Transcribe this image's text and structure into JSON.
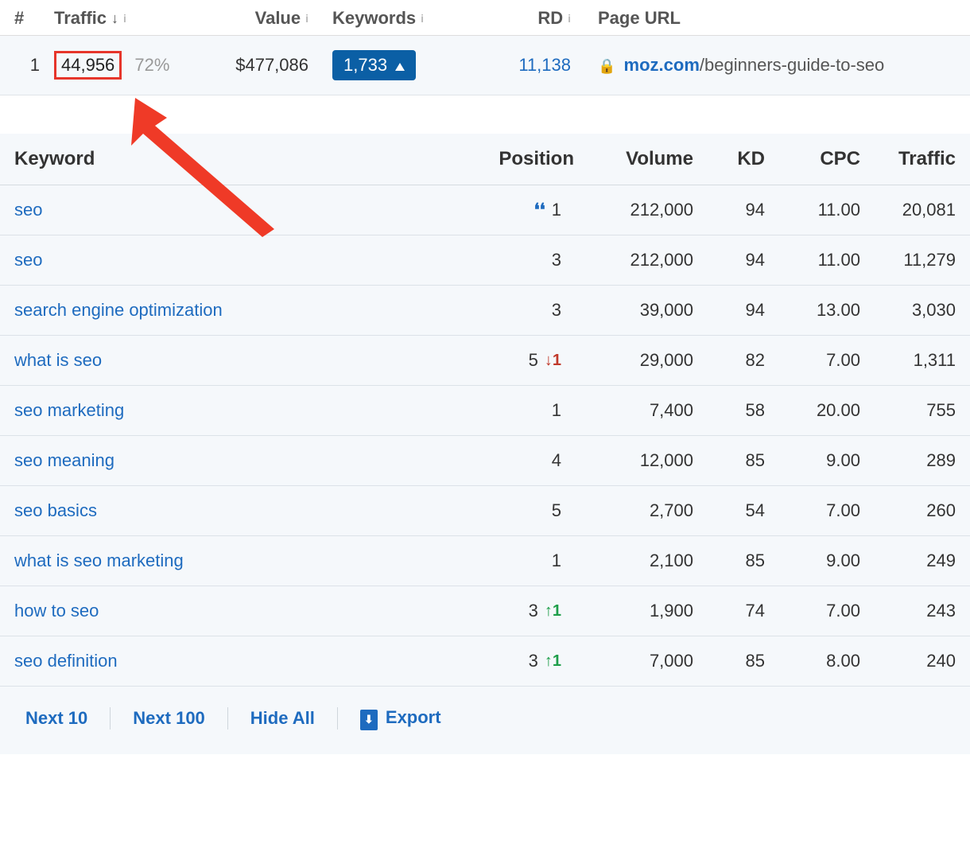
{
  "top_header": {
    "idx": "#",
    "traffic": "Traffic",
    "value": "Value",
    "keywords": "Keywords",
    "rd": "RD",
    "url": "Page URL",
    "sort_desc": "↓",
    "info_glyph": "i"
  },
  "top_row": {
    "idx": "1",
    "traffic": "44,956",
    "traffic_pct": "72%",
    "value": "$477,086",
    "keywords": "1,733",
    "rd": "11,138",
    "url_host": "moz.com",
    "url_path": "/beginners-guide-to-seo"
  },
  "kw_header": {
    "keyword": "Keyword",
    "position": "Position",
    "volume": "Volume",
    "kd": "KD",
    "cpc": "CPC",
    "traffic": "Traffic"
  },
  "keywords": [
    {
      "kw": "seo",
      "serp": true,
      "pos": "1",
      "delta": "",
      "dir": "",
      "volume": "212,000",
      "kd": "94",
      "cpc": "11.00",
      "traffic": "20,081"
    },
    {
      "kw": "seo",
      "serp": false,
      "pos": "3",
      "delta": "",
      "dir": "",
      "volume": "212,000",
      "kd": "94",
      "cpc": "11.00",
      "traffic": "11,279"
    },
    {
      "kw": "search engine optimization",
      "serp": false,
      "pos": "3",
      "delta": "",
      "dir": "",
      "volume": "39,000",
      "kd": "94",
      "cpc": "13.00",
      "traffic": "3,030"
    },
    {
      "kw": "what is seo",
      "serp": false,
      "pos": "5",
      "delta": "↓1",
      "dir": "down",
      "volume": "29,000",
      "kd": "82",
      "cpc": "7.00",
      "traffic": "1,311"
    },
    {
      "kw": "seo marketing",
      "serp": false,
      "pos": "1",
      "delta": "",
      "dir": "",
      "volume": "7,400",
      "kd": "58",
      "cpc": "20.00",
      "traffic": "755"
    },
    {
      "kw": "seo meaning",
      "serp": false,
      "pos": "4",
      "delta": "",
      "dir": "",
      "volume": "12,000",
      "kd": "85",
      "cpc": "9.00",
      "traffic": "289"
    },
    {
      "kw": "seo basics",
      "serp": false,
      "pos": "5",
      "delta": "",
      "dir": "",
      "volume": "2,700",
      "kd": "54",
      "cpc": "7.00",
      "traffic": "260"
    },
    {
      "kw": "what is seo marketing",
      "serp": false,
      "pos": "1",
      "delta": "",
      "dir": "",
      "volume": "2,100",
      "kd": "85",
      "cpc": "9.00",
      "traffic": "249"
    },
    {
      "kw": "how to seo",
      "serp": false,
      "pos": "3",
      "delta": "↑1",
      "dir": "up",
      "volume": "1,900",
      "kd": "74",
      "cpc": "7.00",
      "traffic": "243"
    },
    {
      "kw": "seo definition",
      "serp": false,
      "pos": "3",
      "delta": "↑1",
      "dir": "up",
      "volume": "7,000",
      "kd": "85",
      "cpc": "8.00",
      "traffic": "240"
    }
  ],
  "footer": {
    "next10": "Next 10",
    "next100": "Next 100",
    "hideall": "Hide All",
    "export": "Export"
  },
  "glyphs": {
    "serp_feature": "❛❛",
    "lock": "🔒",
    "download": "⬇"
  }
}
